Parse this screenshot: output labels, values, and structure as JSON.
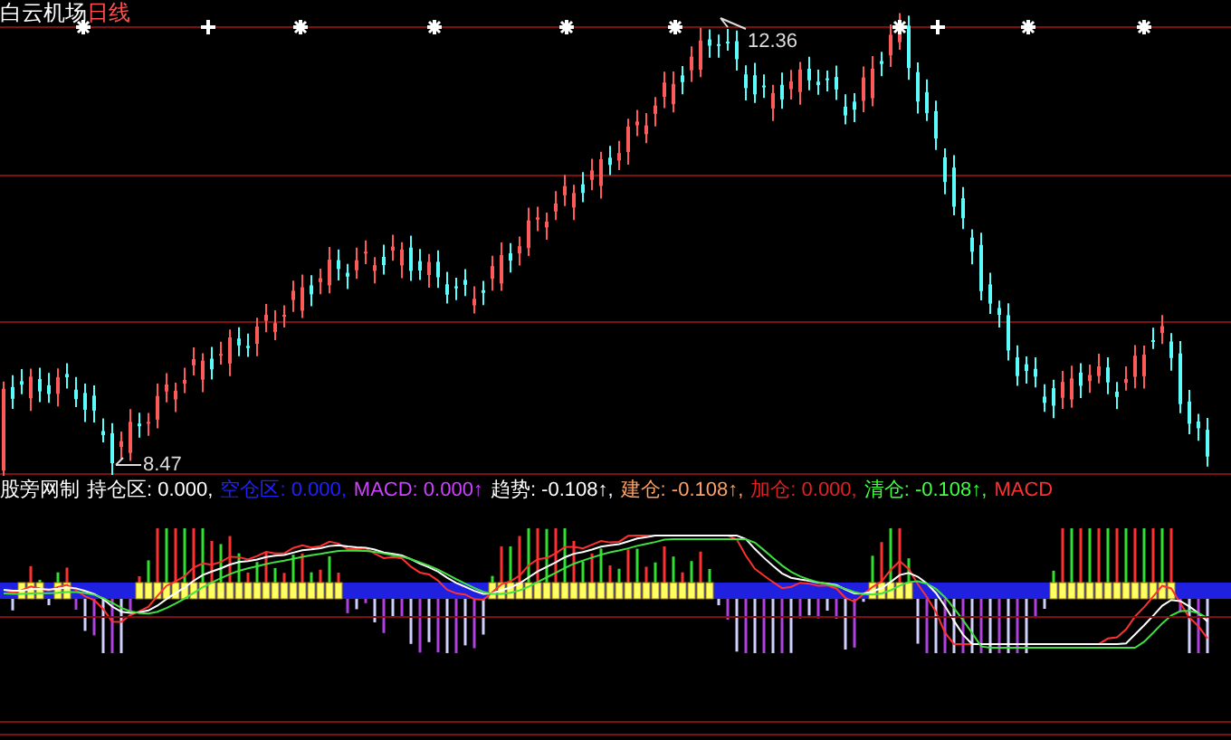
{
  "title": {
    "name": "白云机场",
    "period": "日线"
  },
  "markers": [
    {
      "kind": "star"
    },
    {
      "kind": "plus"
    },
    {
      "kind": "star"
    },
    {
      "kind": "star"
    },
    {
      "kind": "star"
    },
    {
      "kind": "star"
    },
    {
      "kind": "star"
    },
    {
      "kind": "plus"
    },
    {
      "kind": "star"
    },
    {
      "kind": "star"
    }
  ],
  "price_labels": {
    "high": "12.36",
    "low": "8.47"
  },
  "indicator": {
    "name": "股旁网制",
    "items": [
      {
        "text": "持仓区: 0.000,",
        "color": "#ffffff"
      },
      {
        "text": "空仓区: 0.000,",
        "color": "#2020ff"
      },
      {
        "text": "MACD: 0.000↑",
        "color": "#d040ff"
      },
      {
        "text": "趋势: -0.108↑,",
        "color": "#ffffff"
      },
      {
        "text": "建仓: -0.108↑,",
        "color": "#ffa060"
      },
      {
        "text": "加仓: 0.000,",
        "color": "#e02020"
      },
      {
        "text": "清仓: -0.108↑,",
        "color": "#40ff40"
      },
      {
        "text": "MACD",
        "color": "#ff3030"
      }
    ]
  }
}
